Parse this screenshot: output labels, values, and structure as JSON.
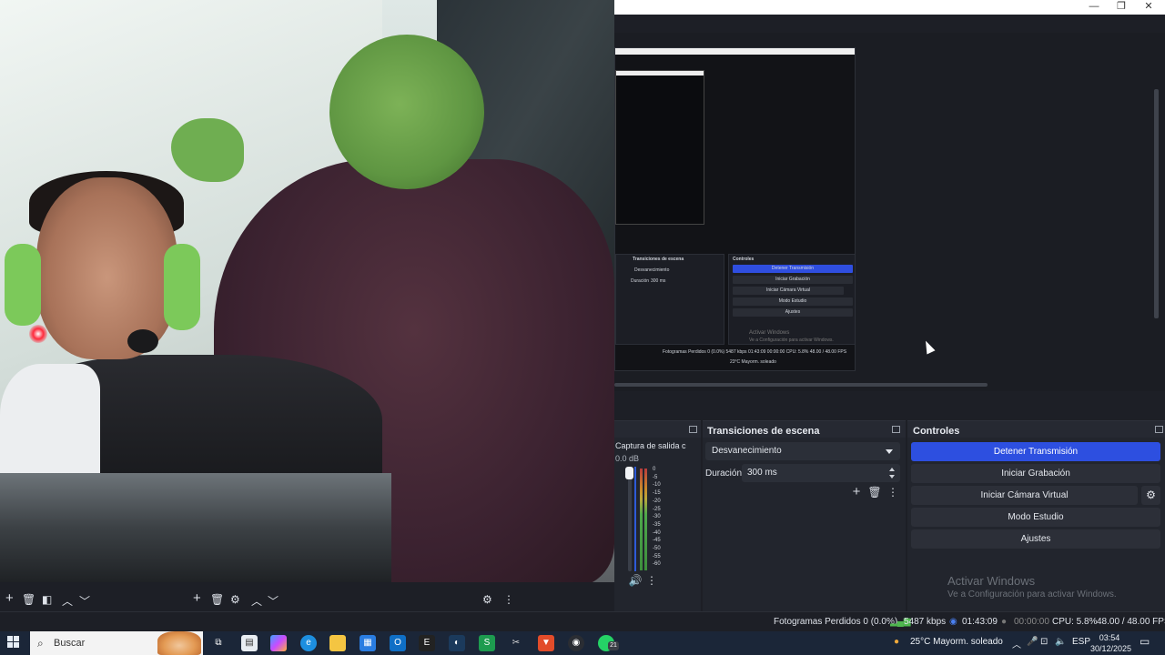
{
  "window": {
    "minimize": "—",
    "restore": "❐",
    "close": "✕"
  },
  "nested_preview": {
    "activate_title": "Activar Windows",
    "activate_sub": "Ve a Configuración para activar Windows.",
    "transitions_title": "Transiciones de escena",
    "controls_title": "Controles",
    "fade": "Desvanecimiento",
    "duration_label": "Duración",
    "duration_value": "300 ms",
    "buttons": [
      "Detener Transmisión",
      "Iniciar Grabación",
      "Iniciar Cámara Virtual",
      "Modo Estudio",
      "Ajustes"
    ],
    "status": "Fotogramas Perdidos 0 (0.0%)   5487 kbps   01:43:09   00:00:00   CPU: 5.8%   48.00 / 48.00 FPS",
    "tray": "23°C  Mayorm. soleado"
  },
  "mixer": {
    "source_label": "Captura de salida c",
    "db": "0.0 dB",
    "ticks": [
      "0",
      "-5",
      "-10",
      "-15",
      "-20",
      "-25",
      "-30",
      "-35",
      "-40",
      "-45",
      "-50",
      "-55",
      "-60"
    ]
  },
  "transitions": {
    "title": "Transiciones de escena",
    "selected": "Desvanecimiento",
    "duration_label": "Duración",
    "duration_value": "300 ms"
  },
  "controls": {
    "title": "Controles",
    "stop_stream": "Detener Transmisión",
    "start_recording": "Iniciar Grabación",
    "start_virtual_cam": "Iniciar Cámara Virtual",
    "studio_mode": "Modo Estudio",
    "settings": "Ajustes"
  },
  "watermark": {
    "title": "Activar Windows",
    "subtitle": "Ve a Configuración para activar Windows."
  },
  "status": {
    "dropped": "Fotogramas Perdidos 0 (0.0%)",
    "bitrate": "5487 kbps",
    "stream_time": "01:43:09",
    "rec_time": "00:00:00",
    "cpu": "CPU: 5.8%",
    "fps": "48.00 / 48.00 FPS"
  },
  "taskbar": {
    "search_placeholder": "Buscar",
    "weather": "25°C  Mayorm. soleado",
    "language": "ESP",
    "time": "03:54",
    "date": "30/12/2025",
    "whatsapp_badge": "21"
  }
}
